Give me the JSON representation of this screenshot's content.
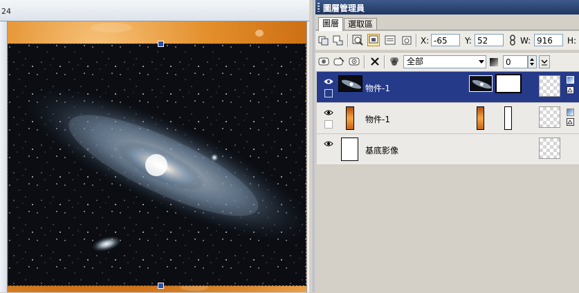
{
  "canvas": {
    "ruler_number": "24",
    "edge_arrow_icon": "right-triangle-icon"
  },
  "panel": {
    "title": "圖層管理員",
    "tabs": [
      {
        "label": "圖層",
        "active": true
      },
      {
        "label": "選取區",
        "active": false
      }
    ],
    "toolbar1": {
      "icons": [
        "copy-layer-icon",
        "merge-layer-icon",
        "zoom-to-object-icon",
        "layer-view-icon",
        "properties-icon",
        "lock-icon"
      ],
      "x_label": "X:",
      "x_value": "-65",
      "y_label": "Y:",
      "y_value": "52",
      "link_icon": "chain-link-icon",
      "w_label": "W:",
      "w_value": "916",
      "h_label": "H:"
    },
    "toolbar2": {
      "icons": [
        "mask-add-icon",
        "mask-edit-icon",
        "mask-view-icon",
        "delete-icon",
        "blend-icon"
      ],
      "blend_mode": "全部",
      "opacity_value": "0"
    },
    "layers": [
      {
        "name": "物件-1",
        "selected": true,
        "thumb": "galaxy",
        "mask": "white-box"
      },
      {
        "name": "物件-1",
        "selected": false,
        "thumb": "orange-strip",
        "mask": "narrow-box"
      },
      {
        "name": "基底影像",
        "selected": false,
        "thumb": "blank",
        "mask": ""
      }
    ]
  },
  "colors": {
    "title_bar": "#2b426f",
    "selected_row": "#263a8a",
    "canvas_orange": "#e38e2a",
    "galaxy_bg": "#0b0d12"
  }
}
